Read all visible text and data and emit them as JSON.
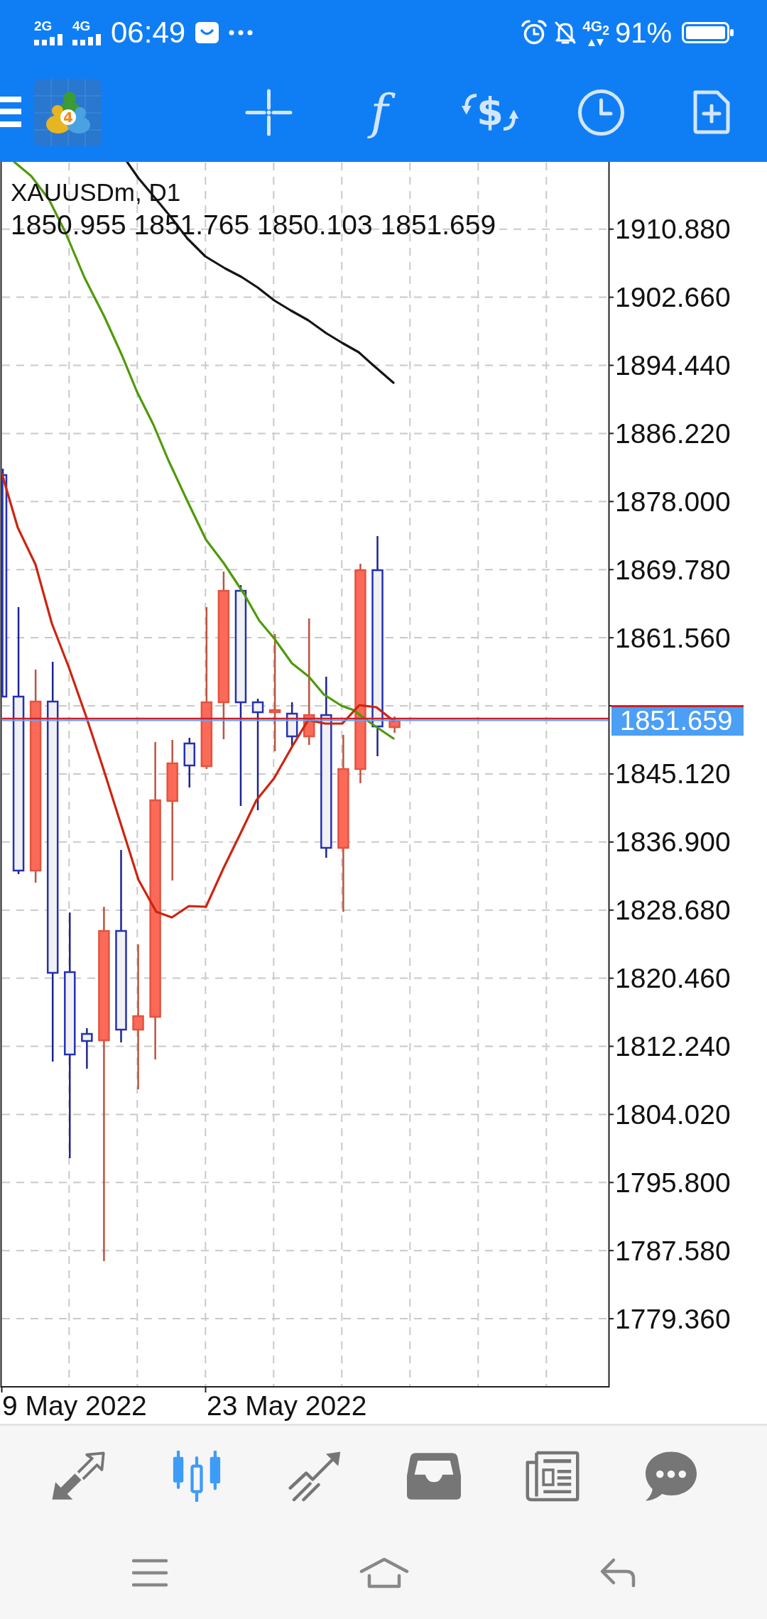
{
  "status_bar": {
    "signals": [
      "2G",
      "4G"
    ],
    "time": "06:49",
    "network": "4G$_{2}$",
    "battery": "91%"
  },
  "toolbar": {
    "logo_label": "4",
    "function_label": "f",
    "currency_label": "$"
  },
  "chart": {
    "symbol": "XAUUSDm, D1",
    "ohlc": "1850.955 1851.765 1850.103 1851.659",
    "price_labels": [
      "1910.880",
      "1902.660",
      "1894.440",
      "1886.220",
      "1878.000",
      "1869.780",
      "1861.560",
      "1845.120",
      "1836.900",
      "1828.680",
      "1820.460",
      "1812.240",
      "1804.020",
      "1795.800",
      "1787.580",
      "1779.360"
    ],
    "current_price": "1851.659",
    "date_labels": [
      "9 May 2022",
      "23 May 2022"
    ]
  },
  "bottom_nav": [
    {
      "kind": "arrows",
      "selected": false
    },
    {
      "kind": "candles",
      "selected": true
    },
    {
      "kind": "trend",
      "selected": false
    },
    {
      "kind": "tray",
      "selected": false
    },
    {
      "kind": "newspaper",
      "selected": false
    },
    {
      "kind": "bubble",
      "selected": false
    }
  ]
}
